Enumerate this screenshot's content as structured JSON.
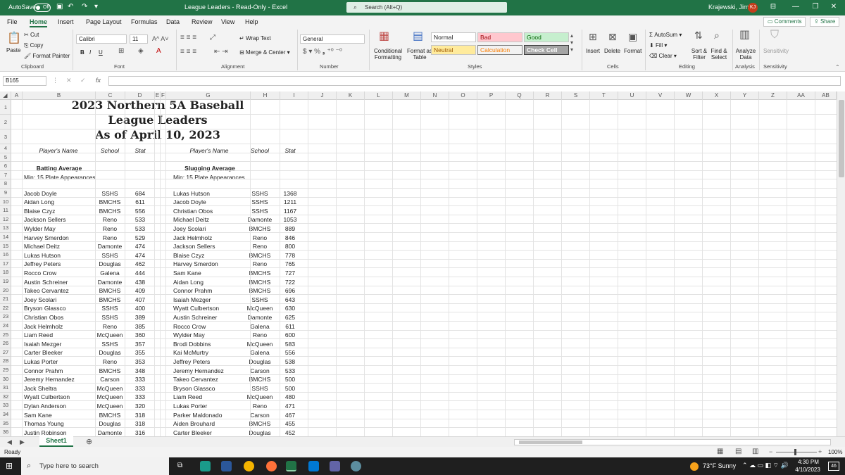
{
  "titlebar": {
    "autosave_label": "AutoSave",
    "autosave_state": "Off",
    "title": "League Leaders  -  Read-Only  -  Excel",
    "search_placeholder": "Search (Alt+Q)",
    "user": "Krajewski, Jim",
    "user_initials": "KJ"
  },
  "menu": {
    "items": [
      "File",
      "Home",
      "Insert",
      "Page Layout",
      "Formulas",
      "Data",
      "Review",
      "View",
      "Help"
    ],
    "active": "Home",
    "comments_label": "Comments",
    "share_label": "Share"
  },
  "ribbon": {
    "paste": "Paste",
    "cut": "Cut",
    "copy": "Copy",
    "format_painter": "Format Painter",
    "clipboard": "Clipboard",
    "font_name": "Calibri",
    "font_size": "11",
    "font_group": "Font",
    "bold": "B",
    "italic": "I",
    "underline": "U",
    "wrap_text": "Wrap Text",
    "merge_center": "Merge & Center",
    "alignment": "Alignment",
    "number_format": "General",
    "number_group": "Number",
    "conditional_formatting": "Conditional Formatting",
    "format_as_table": "Format as Table",
    "styles_group": "Styles",
    "style_normal": "Normal",
    "style_bad": "Bad",
    "style_good": "Good",
    "style_neutral": "Neutral",
    "style_calculation": "Calculation",
    "style_check_cell": "Check Cell",
    "insert": "Insert",
    "delete": "Delete",
    "format": "Format",
    "cells_group": "Cells",
    "autosum": "AutoSum",
    "fill": "Fill",
    "clear": "Clear",
    "sort_filter": "Sort & Filter",
    "find_select": "Find & Select",
    "editing_group": "Editing",
    "analyze_data": "Analyze Data",
    "analysis_group": "Analysis",
    "sensitivity": "Sensitivity",
    "sensitivity_group": "Sensitivity"
  },
  "formula_bar": {
    "name_box": "B165",
    "fx": "fx",
    "value": ""
  },
  "columns": [
    "A",
    "B",
    "C",
    "D",
    "E",
    "F",
    "G",
    "H",
    "I",
    "J",
    "K",
    "L",
    "M",
    "N",
    "O",
    "P",
    "Q",
    "R",
    "S",
    "T",
    "U",
    "V",
    "W",
    "X",
    "Y",
    "Z",
    "AA",
    "AB"
  ],
  "rows": [
    "1",
    "2",
    "3",
    "4",
    "5",
    "6",
    "7",
    "8",
    "9",
    "10",
    "11",
    "12",
    "13",
    "14",
    "15",
    "16",
    "17",
    "18",
    "19",
    "20",
    "21",
    "22",
    "23",
    "24",
    "25",
    "26",
    "27",
    "28",
    "29",
    "30",
    "31",
    "32",
    "33",
    "34",
    "35",
    "36"
  ],
  "sheet": {
    "title_1": "2023 Northern 5A Baseball",
    "title_2": "League Leaders",
    "title_3": "As of April 10, 2023",
    "hdr_player": "Player's Name",
    "hdr_school": "School",
    "hdr_stat": "Stat",
    "left_category": "Batting Average",
    "left_min": "Min: 15 Plate Appearances",
    "right_category": "Slugging Average",
    "right_min": "Min: 15 Plate Appearances",
    "left_rows": [
      [
        "Jacob Doyle",
        "SSHS",
        "684"
      ],
      [
        "Aidan Long",
        "BMCHS",
        "611"
      ],
      [
        "Blaise Czyz",
        "BMCHS",
        "556"
      ],
      [
        "Jackson Sellers",
        "Reno",
        "533"
      ],
      [
        "Wylder May",
        "Reno",
        "533"
      ],
      [
        "Harvey Smerdon",
        "Reno",
        "529"
      ],
      [
        "Michael Deitz",
        "Damonte",
        "474"
      ],
      [
        "Lukas Hutson",
        "SSHS",
        "474"
      ],
      [
        "Jeffrey Peters",
        "Douglas",
        "462"
      ],
      [
        "Rocco Crow",
        "Galena",
        "444"
      ],
      [
        "Austin Schreiner",
        "Damonte",
        "438"
      ],
      [
        "Takeo Cervantez",
        "BMCHS",
        "409"
      ],
      [
        "Joey Scolari",
        "BMCHS",
        "407"
      ],
      [
        "Bryson Glassco",
        "SSHS",
        "400"
      ],
      [
        "Christian Obos",
        "SSHS",
        "389"
      ],
      [
        "Jack Helmholz",
        "Reno",
        "385"
      ],
      [
        "Liam Reed",
        "McQueen",
        "360"
      ],
      [
        "Isaiah Mezger",
        "SSHS",
        "357"
      ],
      [
        "Carter Bleeker",
        "Douglas",
        "355"
      ],
      [
        "Lukas Porter",
        "Reno",
        "353"
      ],
      [
        "Connor Prahm",
        "BMCHS",
        "348"
      ],
      [
        "Jeremy Hernandez",
        "Carson",
        "333"
      ],
      [
        "Jack Sheltra",
        "McQueen",
        "333"
      ],
      [
        "Wyatt Culbertson",
        "McQueen",
        "333"
      ],
      [
        "Dylan Anderson",
        "McQueen",
        "320"
      ],
      [
        "Sam Kane",
        "BMCHS",
        "318"
      ],
      [
        "Thomas Young",
        "Douglas",
        "318"
      ],
      [
        "Justin Robinson",
        "Damonte",
        "316"
      ]
    ],
    "right_rows": [
      [
        "Lukas Hutson",
        "SSHS",
        "1368"
      ],
      [
        "Jacob Doyle",
        "SSHS",
        "1211"
      ],
      [
        "Christian Obos",
        "SSHS",
        "1167"
      ],
      [
        "Michael Deitz",
        "Damonte",
        "1053"
      ],
      [
        "Joey Scolari",
        "BMCHS",
        "889"
      ],
      [
        "Jack Helmholz",
        "Reno",
        "846"
      ],
      [
        "Jackson Sellers",
        "Reno",
        "800"
      ],
      [
        "Blaise Czyz",
        "BMCHS",
        "778"
      ],
      [
        "Harvey Smerdon",
        "Reno",
        "765"
      ],
      [
        "Sam Kane",
        "BMCHS",
        "727"
      ],
      [
        "Aidan Long",
        "BMCHS",
        "722"
      ],
      [
        "Connor Prahm",
        "BMCHS",
        "696"
      ],
      [
        "Isaiah Mezger",
        "SSHS",
        "643"
      ],
      [
        "Wyatt Culbertson",
        "McQueen",
        "630"
      ],
      [
        "Austin Schreiner",
        "Damonte",
        "625"
      ],
      [
        "Rocco Crow",
        "Galena",
        "611"
      ],
      [
        "Wylder May",
        "Reno",
        "600"
      ],
      [
        "Brodi Dobbins",
        "McQueen",
        "583"
      ],
      [
        "Kai McMurtry",
        "Galena",
        "556"
      ],
      [
        "Jeffrey Peters",
        "Douglas",
        "538"
      ],
      [
        "Jeremy Hernandez",
        "Carson",
        "533"
      ],
      [
        "Takeo Cervantez",
        "BMCHS",
        "500"
      ],
      [
        "Bryson Glassco",
        "SSHS",
        "500"
      ],
      [
        "Liam Reed",
        "McQueen",
        "480"
      ],
      [
        "Lukas Porter",
        "Reno",
        "471"
      ],
      [
        "Parker Maldonado",
        "Carson",
        "467"
      ],
      [
        "Aiden Brouhard",
        "BMCHS",
        "455"
      ],
      [
        "Carter Bleeker",
        "Douglas",
        "452"
      ]
    ]
  },
  "sheet_tab": "Sheet1",
  "status": {
    "ready": "Ready",
    "zoom": "100%"
  },
  "taskbar": {
    "search_placeholder": "Type here to search",
    "weather": "73°F  Sunny",
    "time": "4:30 PM",
    "date": "4/10/2023",
    "notifications": "46"
  },
  "colors": {
    "excel_green": "#217346",
    "bad_bg": "#ffc7ce",
    "good_bg": "#c6efce",
    "neutral_bg": "#ffeb9c",
    "check_cell_bg": "#a5a5a5"
  }
}
